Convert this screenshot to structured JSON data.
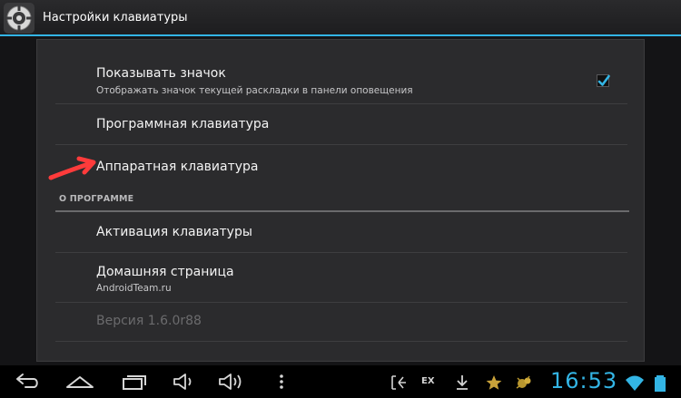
{
  "app": {
    "title": "Настройки клавиатуры"
  },
  "preferences": {
    "show_icon": {
      "title": "Показывать значок",
      "summary": "Отображать значок текущей раскладки в панели оповещения",
      "checked": true
    },
    "software_keyboard": {
      "title": "Программная клавиатура"
    },
    "hardware_keyboard": {
      "title": "Аппаратная клавиатура"
    },
    "about_category": {
      "title": "О ПРОГРАММЕ"
    },
    "activation": {
      "title": "Активация клавиатуры"
    },
    "homepage": {
      "title": "Домашняя страница",
      "summary": "AndroidTeam.ru"
    },
    "version": {
      "title": "Версия 1.6.0r88",
      "enabled": false
    }
  },
  "status_bar": {
    "ex_label": "EX",
    "clock": "16:53",
    "accent_color": "#33b5e5"
  },
  "icons": {
    "app": "app-icon",
    "annotation": "red-arrow-icon",
    "nav": [
      "back-icon",
      "home-icon",
      "recent-apps-icon",
      "volume-down-icon",
      "volume-up-icon",
      "menu-icon"
    ],
    "status": [
      "keyboard-layout-icon",
      "download-icon",
      "star-icon",
      "android-bug-icon",
      "wifi-icon",
      "battery-icon"
    ]
  }
}
